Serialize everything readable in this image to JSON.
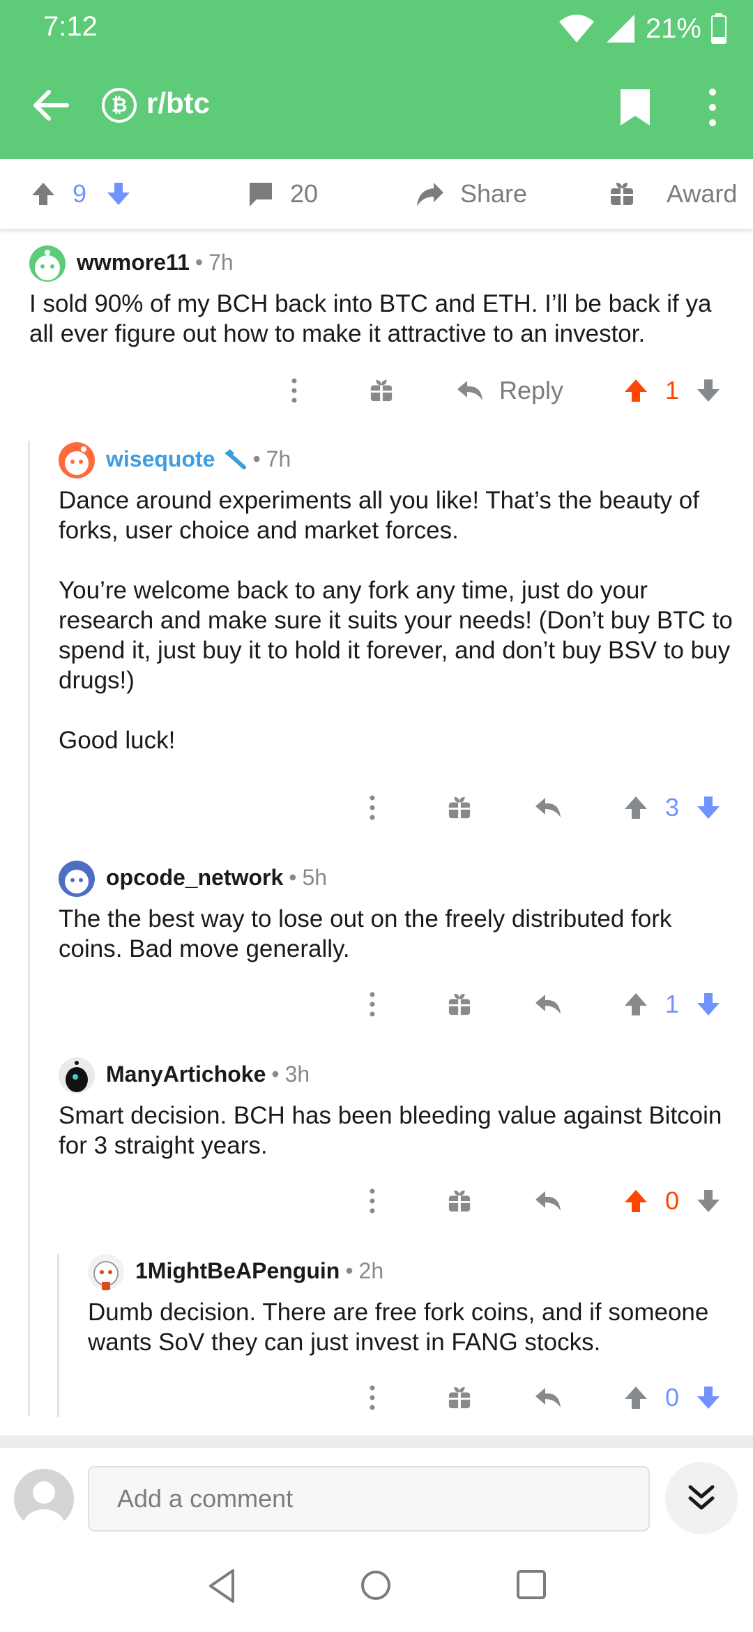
{
  "status_bar": {
    "time": "7:12",
    "battery": "21%"
  },
  "app_bar": {
    "subreddit": "r/btc",
    "sub_icon": "₿"
  },
  "post_actions": {
    "upvotes": "9",
    "comments": "20",
    "share_label": "Share",
    "award_label": "Award"
  },
  "comments": [
    {
      "author": "wwmore11",
      "time": "7h",
      "body": [
        "I sold 90% of my BCH back into BTC and ETH. I’ll be back if ya all ever figure out how to make it attractive to an investor."
      ],
      "reply_label": "Reply",
      "score": "1",
      "vote": "up"
    },
    {
      "author": "wisequote",
      "time": "7h",
      "is_op": true,
      "body": [
        "Dance around experiments all you like! That’s the beauty of forks, user choice and market forces.",
        "You’re welcome back to any fork any time, just do your research and make sure it suits your needs! (Don’t buy BTC to spend it, just buy it to hold it forever, and don’t buy BSV to buy drugs!)",
        "Good luck!"
      ],
      "score": "3",
      "vote": "down"
    },
    {
      "author": "opcode_network",
      "time": "5h",
      "body": [
        "The the best way to lose out on the freely distributed fork coins. Bad move generally."
      ],
      "score": "1",
      "vote": "down"
    },
    {
      "author": "ManyArtichoke",
      "time": "3h",
      "body": [
        "Smart decision. BCH has been bleeding value against Bitcoin for 3 straight years."
      ],
      "score": "0",
      "vote": "up"
    },
    {
      "author": "1MightBeAPenguin",
      "time": "2h",
      "body": [
        "Dumb decision. There are free fork coins, and if someone wants SoV they can just invest in FANG stocks."
      ],
      "score": "0",
      "vote": "down"
    }
  ],
  "composer": {
    "placeholder": "Add a comment"
  },
  "colors": {
    "header": "#5ecb78",
    "upvote": "#ff4500",
    "downvote": "#7193ff",
    "op": "#3e9ce0",
    "icon_gray": "#878a8c"
  },
  "icons": [
    "back-arrow-icon",
    "bitcoin-icon",
    "bookmark-icon",
    "more-vert-icon",
    "upvote-arrow-icon",
    "downvote-arrow-icon",
    "comment-bubble-icon",
    "share-icon",
    "gift-icon",
    "reply-icon",
    "chevron-double-down-icon",
    "nav-back-icon",
    "nav-home-icon",
    "nav-recents-icon"
  ]
}
